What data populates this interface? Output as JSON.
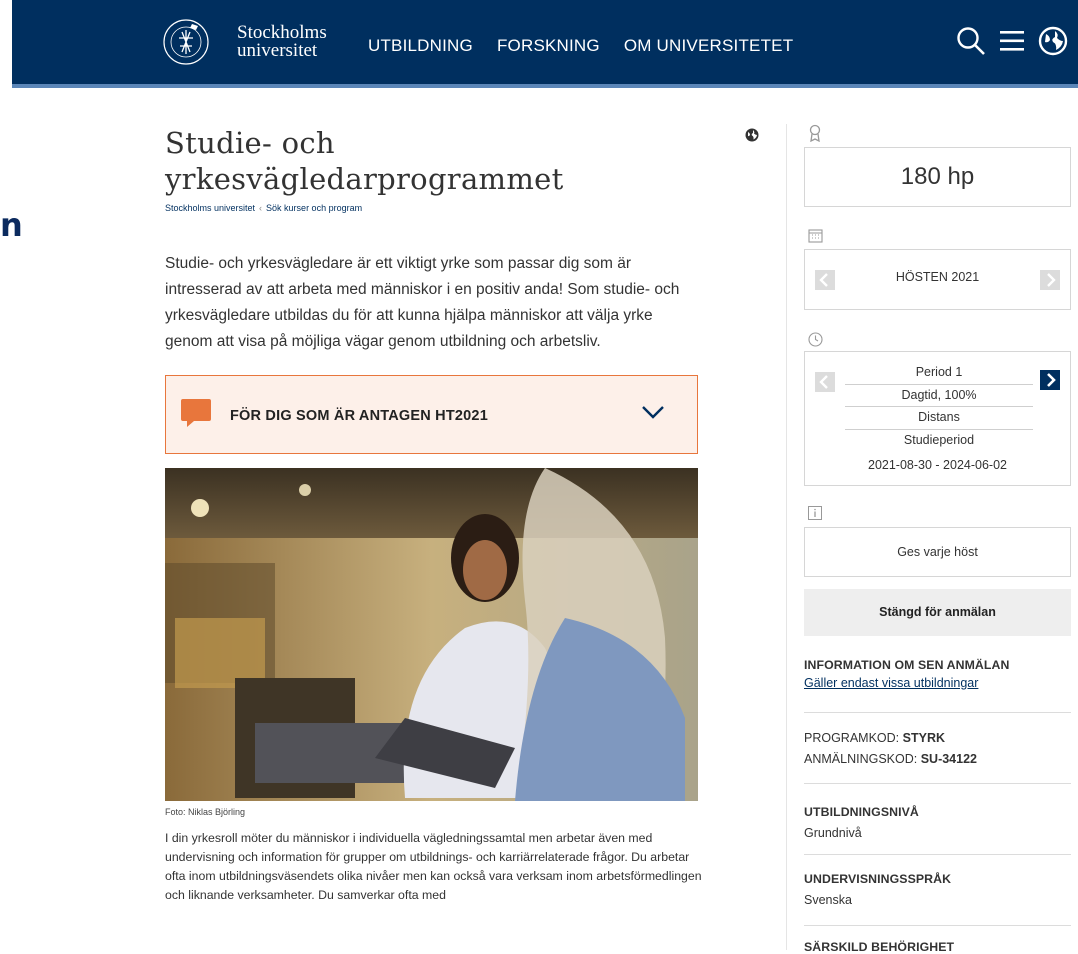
{
  "page": {
    "stray_char": "n"
  },
  "header": {
    "logo_line1": "Stockholms",
    "logo_line2": "universitet",
    "nav": [
      "UTBILDNING",
      "FORSKNING",
      "OM UNIVERSITETET"
    ]
  },
  "main": {
    "title_line1": "Studie- och",
    "title_line2": "yrkesvägledarprogrammet",
    "breadcrumb": [
      "Stockholms universitet",
      "Sök kurser och program"
    ],
    "lead": "Studie- och yrkesvägledare är ett viktigt yrke som passar dig som är intresserad av att arbeta med människor i en positiv anda! Som studie- och yrkesvägledare utbildas du för att kunna hjälpa människor att välja yrke genom att visa på möjliga vägar genom utbildning och arbetsliv.",
    "accordion_label": "FÖR DIG SOM ÄR ANTAGEN HT2021",
    "photo_caption": "Foto: Niklas Björling",
    "body": "I din yrkesroll möter du människor i individuella vägledningssamtal men arbetar även med undervisning och information för grupper om utbildnings- och karriärrelaterade frågor. Du arbetar ofta inom utbildningsväsendets olika nivåer men kan också vara verksam inom arbetsförmedlingen och liknande verksamheter. Du samverkar ofta med"
  },
  "sidebar": {
    "credits": "180 hp",
    "semester": "HÖSTEN 2021",
    "period_rows": [
      "Period 1",
      "Dagtid, 100%",
      "Distans",
      "Studieperiod"
    ],
    "period_dates": "2021-08-30 - 2024-06-02",
    "offered": "Ges varje höst",
    "closed": "Stängd för anmälan",
    "late_app_head": "INFORMATION OM SEN ANMÄLAN",
    "late_app_link": "Gäller endast vissa utbildningar",
    "program_code_label": "PROGRAMKOD:",
    "program_code": "STYRK",
    "app_code_label": "ANMÄLNINGSKOD:",
    "app_code": "SU-34122",
    "level_head": "UTBILDNINGSNIVÅ",
    "level": "Grundnivå",
    "lang_head": "UNDERVISNINGSSPRÅK",
    "lang": "Svenska",
    "eligibility_head": "SÄRSKILD BEHÖRIGHET"
  },
  "colors": {
    "header_bg": "#002f5f",
    "accent_orange": "#e8763c",
    "accordion_bg": "#fdf0e9"
  },
  "icons": [
    "university-seal",
    "search-icon",
    "menu-icon",
    "globe-icon",
    "speech-bubble-icon",
    "chevron-down-icon",
    "award-icon",
    "calendar-icon",
    "clock-icon",
    "info-icon",
    "chevron-left-icon",
    "chevron-right-icon"
  ]
}
